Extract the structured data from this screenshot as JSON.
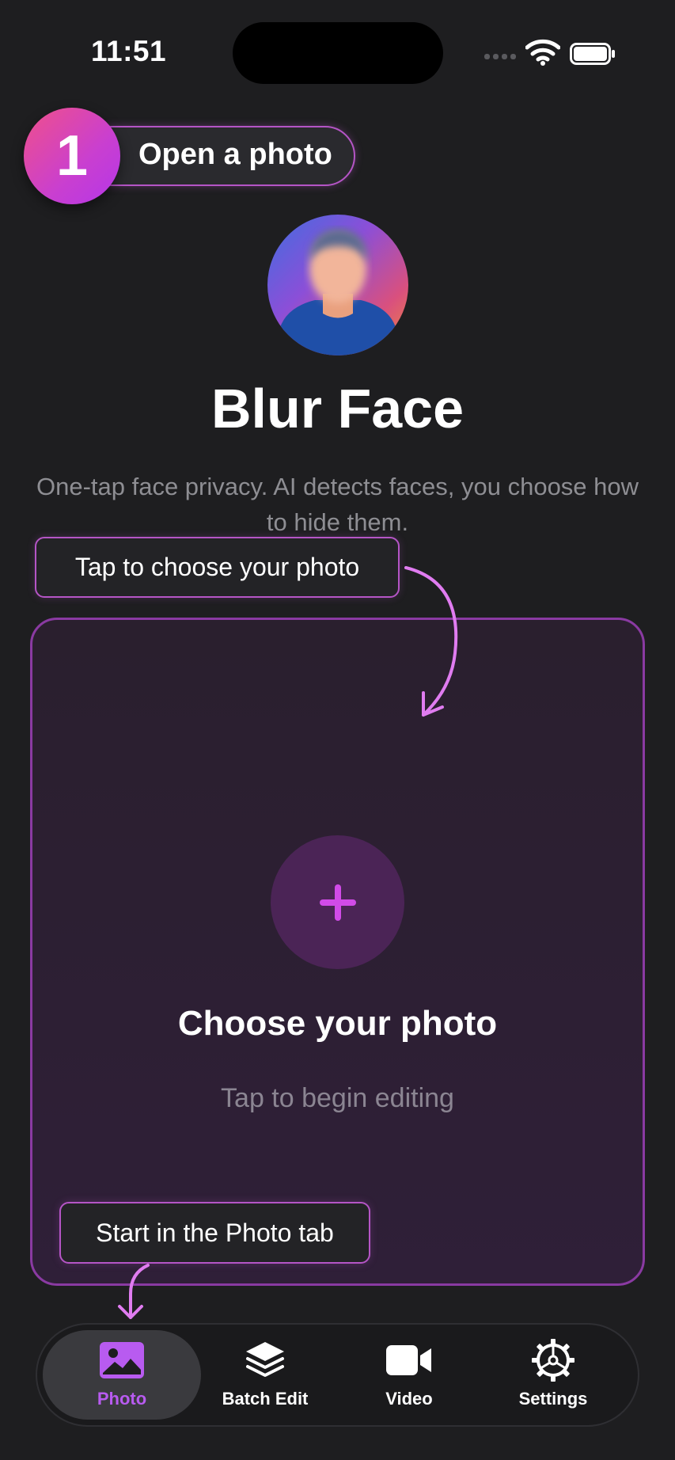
{
  "status_bar": {
    "time": "11:51"
  },
  "onboarding": {
    "step_number": "1",
    "step_label": "Open a photo",
    "tooltip_choose": "Tap to choose your photo",
    "tooltip_tab": "Start in the Photo tab"
  },
  "header": {
    "title": "Blur Face",
    "subtitle": "One-tap face privacy. AI detects faces, you choose how to hide them."
  },
  "dropzone": {
    "title": "Choose your photo",
    "subtitle": "Tap to begin editing",
    "icon": "plus-icon"
  },
  "tabs": [
    {
      "label": "Photo",
      "icon": "photo-icon",
      "active": true
    },
    {
      "label": "Batch Edit",
      "icon": "layers-icon",
      "active": false
    },
    {
      "label": "Video",
      "icon": "video-camera-icon",
      "active": false
    },
    {
      "label": "Settings",
      "icon": "gear-icon",
      "active": false
    }
  ],
  "colors": {
    "accent": "#b85bf0",
    "highlight_border": "#b555c6",
    "background": "#1e1e20"
  }
}
